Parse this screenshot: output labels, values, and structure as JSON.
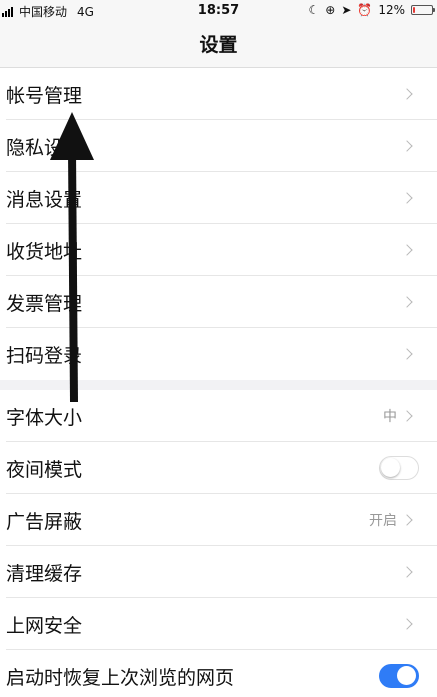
{
  "status": {
    "carrier": "中国移动",
    "network": "4G",
    "time": "18:57",
    "battery_percent": "12%",
    "battery_level": 0.12,
    "icons": [
      "moon-icon",
      "rotation-lock-icon",
      "location-icon",
      "alarm-icon"
    ],
    "battery_color": "#e53935"
  },
  "navbar": {
    "title": "设置"
  },
  "group1": [
    {
      "label": "帐号管理"
    },
    {
      "label": "隐私设置"
    },
    {
      "label": "消息设置"
    },
    {
      "label": "收货地址"
    },
    {
      "label": "发票管理"
    },
    {
      "label": "扫码登录"
    }
  ],
  "group2": [
    {
      "label": "字体大小",
      "value": "中"
    },
    {
      "label": "夜间模式",
      "toggle": false
    },
    {
      "label": "广告屏蔽",
      "value": "开启"
    },
    {
      "label": "清理缓存"
    },
    {
      "label": "上网安全"
    },
    {
      "label": "启动时恢复上次浏览的网页",
      "toggle": true
    }
  ],
  "colors": {
    "toggle_on": "#2f7cf6",
    "annotation_arrow": "#111111"
  }
}
